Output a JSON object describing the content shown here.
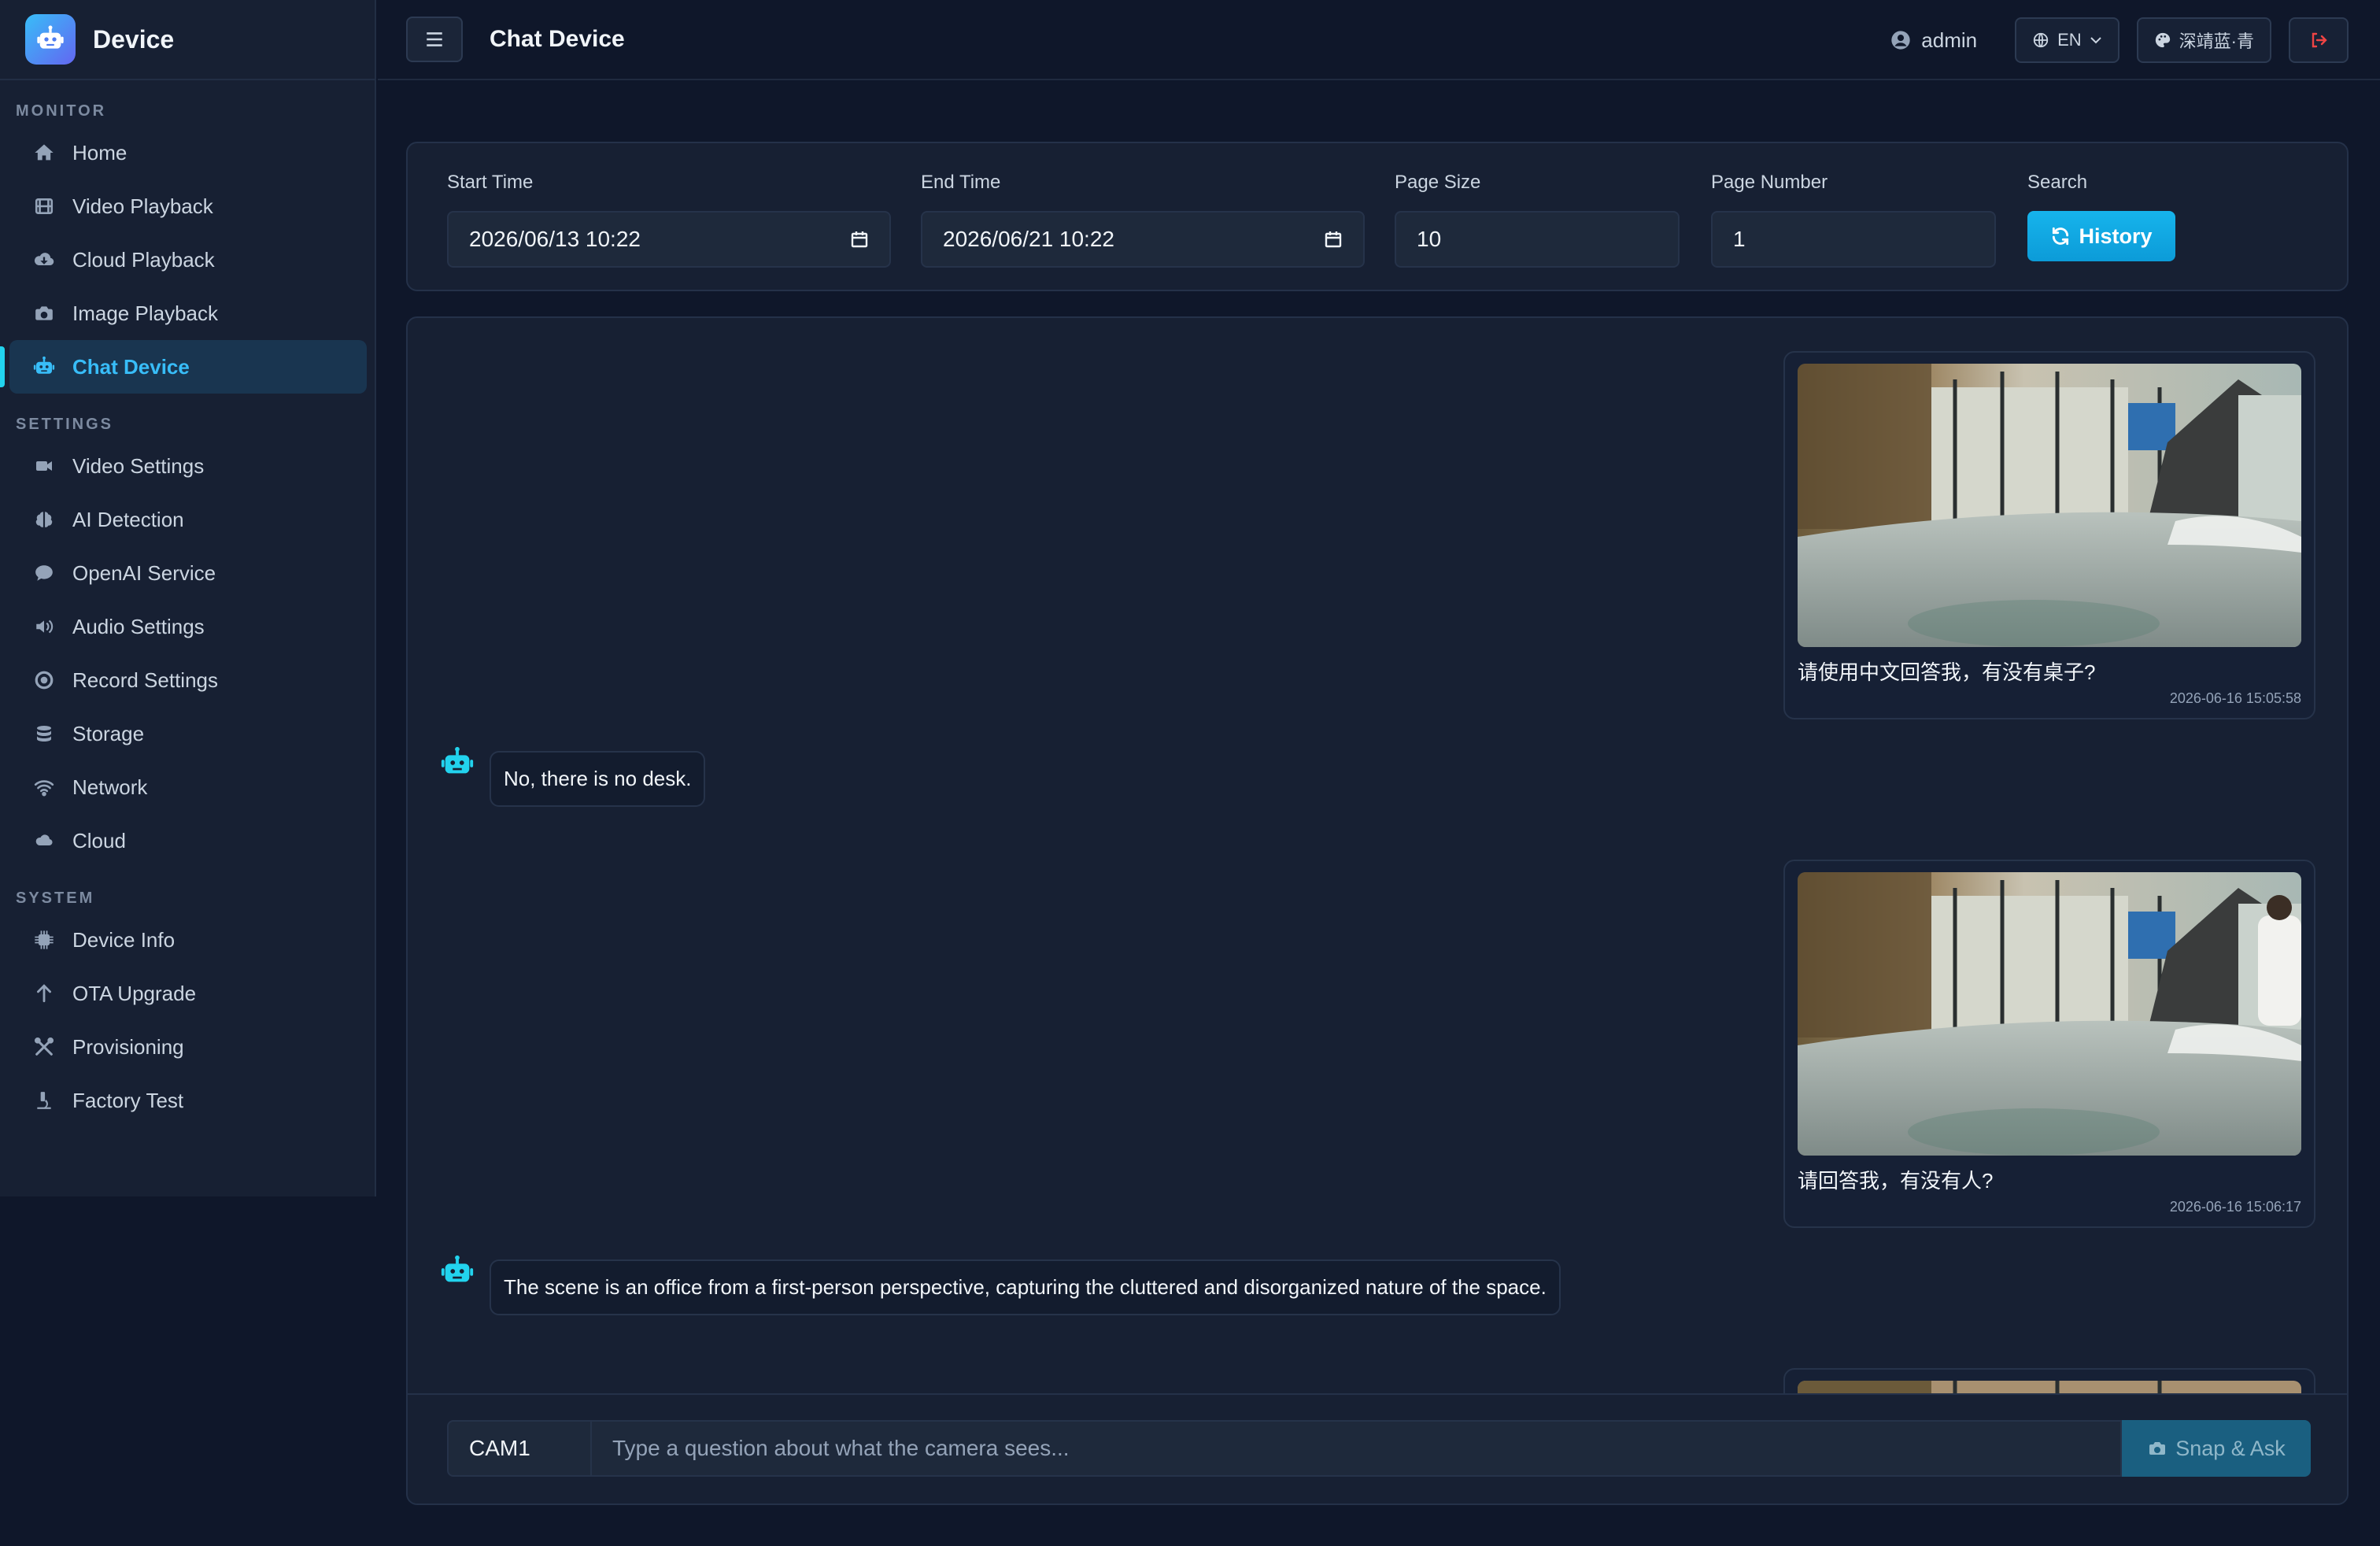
{
  "brand": {
    "name": "Device",
    "logo_icon": "robot-icon"
  },
  "sidebar": {
    "sections": [
      {
        "title": "MONITOR",
        "items": [
          {
            "label": "Home",
            "icon": "home-icon"
          },
          {
            "label": "Video Playback",
            "icon": "film-icon"
          },
          {
            "label": "Cloud Playback",
            "icon": "cloud-download-icon"
          },
          {
            "label": "Image Playback",
            "icon": "camera-icon"
          },
          {
            "label": "Chat Device",
            "icon": "robot-icon",
            "active": true
          }
        ]
      },
      {
        "title": "SETTINGS",
        "items": [
          {
            "label": "Video Settings",
            "icon": "video-icon"
          },
          {
            "label": "AI Detection",
            "icon": "brain-icon"
          },
          {
            "label": "OpenAI Service",
            "icon": "chat-icon"
          },
          {
            "label": "Audio Settings",
            "icon": "speaker-icon"
          },
          {
            "label": "Record Settings",
            "icon": "record-icon"
          },
          {
            "label": "Storage",
            "icon": "database-icon"
          },
          {
            "label": "Network",
            "icon": "wifi-icon"
          },
          {
            "label": "Cloud",
            "icon": "cloud-icon"
          }
        ]
      },
      {
        "title": "SYSTEM",
        "items": [
          {
            "label": "Device Info",
            "icon": "chip-icon"
          },
          {
            "label": "OTA Upgrade",
            "icon": "arrow-up-icon"
          },
          {
            "label": "Provisioning",
            "icon": "tools-icon"
          },
          {
            "label": "Factory Test",
            "icon": "microscope-icon"
          }
        ]
      }
    ]
  },
  "header": {
    "title": "Chat Device",
    "user": "admin",
    "language": "EN",
    "theme": "深靖蓝·青"
  },
  "filters": {
    "start_time": {
      "label": "Start Time",
      "value": "2026/06/13 10:22"
    },
    "end_time": {
      "label": "End Time",
      "value": "2026/06/21 10:22"
    },
    "page_size": {
      "label": "Page Size",
      "value": "10"
    },
    "page_number": {
      "label": "Page Number",
      "value": "1"
    },
    "search": {
      "label": "Search",
      "button": "History"
    }
  },
  "messages": [
    {
      "type": "user",
      "text": "请使用中文回答我，有没有桌子?",
      "time": "2026-06-16 15:05:58"
    },
    {
      "type": "bot",
      "text": "No, there is no desk."
    },
    {
      "type": "user",
      "text": "请回答我，有没有人?",
      "time": "2026-06-16 15:06:17"
    },
    {
      "type": "bot",
      "text": "The scene is an office from a first-person perspective, capturing the cluttered and disorganized nature of the space."
    }
  ],
  "composer": {
    "camera": "CAM1",
    "placeholder": "Type a question about what the camera sees...",
    "button": "Snap & Ask"
  },
  "colors": {
    "accent": "#22d3ee",
    "primary_button": "#0ea5e9",
    "danger": "#ef4444",
    "background": "#0f172a"
  }
}
